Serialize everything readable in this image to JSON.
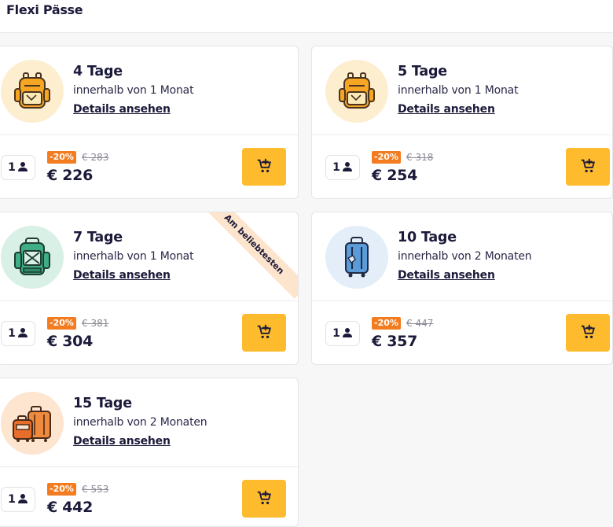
{
  "page": {
    "title": "Flexi Pässe"
  },
  "colors": {
    "accent_button": "#fdbb2d",
    "discount_badge": "#f37c20",
    "ribbon": "#fde4cc",
    "text": "#1b1a3a"
  },
  "common": {
    "details_label": "Details ansehen",
    "traveler_count": "1",
    "traveler_icon": "person-icon",
    "cart_icon": "add-to-cart-icon"
  },
  "passes": [
    {
      "name": "4 Tage",
      "validity": "innerhalb von 1 Monat",
      "discount": "-20%",
      "old_price": "€ 283",
      "price": "€ 226",
      "icon": "backpack-icon",
      "icon_bg": "light-orange"
    },
    {
      "name": "5 Tage",
      "validity": "innerhalb von 1 Monat",
      "discount": "-20%",
      "old_price": "€ 318",
      "price": "€ 254",
      "icon": "backpack-icon",
      "icon_bg": "light-orange"
    },
    {
      "name": "7 Tage",
      "validity": "innerhalb von 1 Monat",
      "discount": "-20%",
      "old_price": "€ 381",
      "price": "€ 304",
      "icon": "green-backpack-icon",
      "icon_bg": "light-green",
      "ribbon": "Am beliebtesten"
    },
    {
      "name": "10 Tage",
      "validity": "innerhalb von 2 Monaten",
      "discount": "-20%",
      "old_price": "€ 447",
      "price": "€ 357",
      "icon": "suitcase-icon",
      "icon_bg": "light-blue"
    },
    {
      "name": "15 Tage",
      "validity": "innerhalb von 2 Monaten",
      "discount": "-20%",
      "old_price": "€ 553",
      "price": "€ 442",
      "icon": "luggage-set-icon",
      "icon_bg": "light-peach"
    }
  ]
}
